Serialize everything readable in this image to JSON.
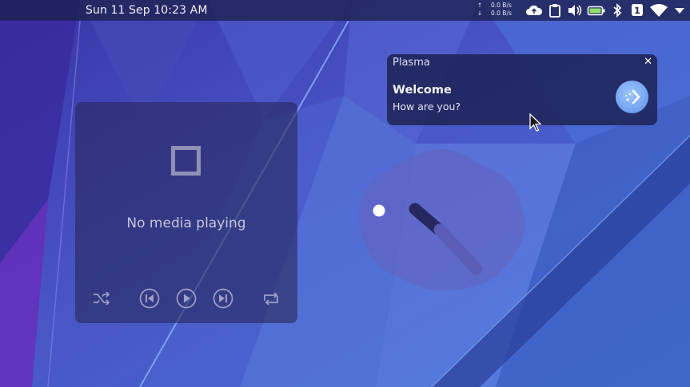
{
  "panel": {
    "datetime": "Sun 11 Sep  10:23 AM",
    "upload_speed": "0.0 B/s",
    "download_speed": "0.0 B/s",
    "upload_arrow": "↑",
    "download_arrow": "↓",
    "notification_count": "1",
    "tray_icons": [
      "cloud-upload-icon",
      "clipboard-icon",
      "volume-icon",
      "battery-icon",
      "bluetooth-icon",
      "notifications-icon",
      "wifi-icon",
      "expand-tray-icon"
    ]
  },
  "media_player": {
    "status_text": "No media playing",
    "controls": [
      "shuffle-icon",
      "previous-icon",
      "play-icon",
      "next-icon",
      "repeat-icon"
    ]
  },
  "notification": {
    "app_name": "Plasma",
    "close_label": "✕",
    "summary": "Welcome",
    "body": "How are you?",
    "app_icon": "plasma-discover-icon"
  },
  "clock": {
    "time": "10:23"
  },
  "colors": {
    "panel_bg": "#1c204e",
    "accent": "#6f9ff0",
    "text": "#f2f2f8",
    "muted_text": "#c4c6dc"
  }
}
